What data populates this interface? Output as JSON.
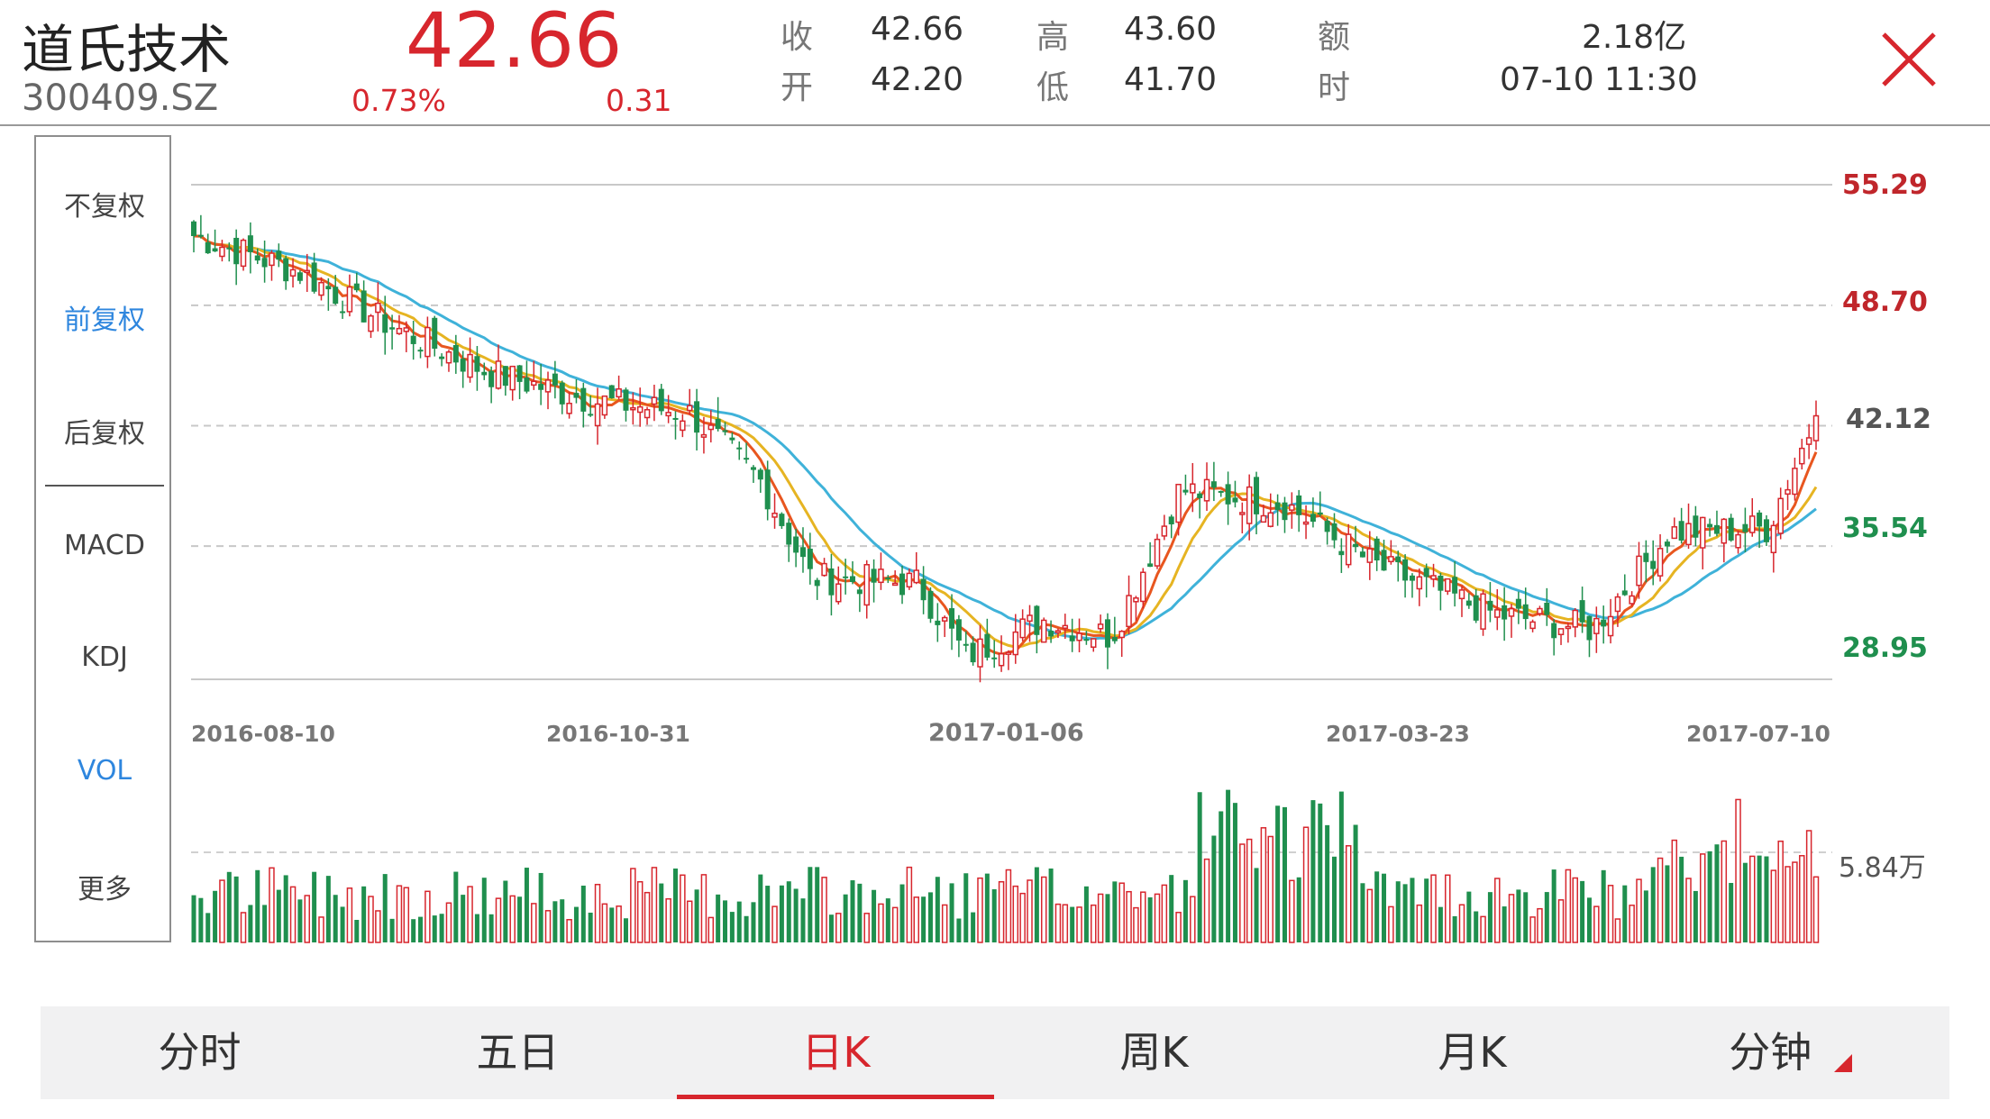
{
  "stock": {
    "name": "道氏技术",
    "code": "300409.SZ",
    "price": "42.66",
    "change_pct": "0.73%",
    "change": "0.31"
  },
  "quote": [
    {
      "label": "收",
      "value": "42.66"
    },
    {
      "label": "开",
      "value": "42.20"
    },
    {
      "label": "高",
      "value": "43.60"
    },
    {
      "label": "低",
      "value": "41.70"
    },
    {
      "label": "额",
      "value": "2.18亿"
    },
    {
      "label": "时",
      "value": "07-10 11:30"
    }
  ],
  "side_menu": [
    {
      "label": "不复权",
      "active": false
    },
    {
      "label": "前复权",
      "active": true
    },
    {
      "label": "后复权",
      "active": false
    },
    {
      "label": "MACD",
      "active": false
    },
    {
      "label": "KDJ",
      "active": false
    },
    {
      "label": "VOL",
      "active": true
    },
    {
      "label": "更多",
      "active": false
    }
  ],
  "tabs": [
    {
      "label": "分时"
    },
    {
      "label": "五日"
    },
    {
      "label": "日K",
      "active": true
    },
    {
      "label": "周K"
    },
    {
      "label": "月K"
    },
    {
      "label": "分钟"
    }
  ],
  "colors": {
    "up": "#d7262d",
    "down": "#1f8f4e",
    "accent": "#2e86de",
    "ma_short": "#e8561f",
    "ma_mid": "#e6b422",
    "ma_long": "#3fb2d9"
  },
  "chart_data": {
    "type": "candlestick",
    "price_axis_labels": [
      "55.29",
      "48.70",
      "42.12",
      "35.54",
      "28.95"
    ],
    "ylim": [
      28.95,
      55.29
    ],
    "date_labels": [
      "2016-08-10",
      "2016-10-31",
      "2017-01-06",
      "2017-03-23",
      "2017-07-10"
    ],
    "volume_axis_label": "5.84万",
    "close_trend": [
      {
        "date": "2016-08-10",
        "close": 52.5
      },
      {
        "date": "2016-09-01",
        "close": 50.5
      },
      {
        "date": "2016-09-20",
        "close": 47.5
      },
      {
        "date": "2016-10-10",
        "close": 45.0
      },
      {
        "date": "2016-10-31",
        "close": 43.5
      },
      {
        "date": "2016-11-20",
        "close": 42.8
      },
      {
        "date": "2016-12-05",
        "close": 39.0
      },
      {
        "date": "2016-12-15",
        "close": 33.8
      },
      {
        "date": "2017-01-06",
        "close": 33.5
      },
      {
        "date": "2017-01-16",
        "close": 29.5
      },
      {
        "date": "2017-02-01",
        "close": 31.5
      },
      {
        "date": "2017-02-15",
        "close": 30.6
      },
      {
        "date": "2017-03-01",
        "close": 38.6
      },
      {
        "date": "2017-03-23",
        "close": 37.8
      },
      {
        "date": "2017-04-10",
        "close": 34.5
      },
      {
        "date": "2017-05-05",
        "close": 31.8
      },
      {
        "date": "2017-05-25",
        "close": 31.0
      },
      {
        "date": "2017-06-10",
        "close": 36.3
      },
      {
        "date": "2017-06-30",
        "close": 36.5
      },
      {
        "date": "2017-07-10",
        "close": 42.66
      }
    ],
    "ma_series": [
      "MA5",
      "MA10",
      "MA20"
    ]
  }
}
